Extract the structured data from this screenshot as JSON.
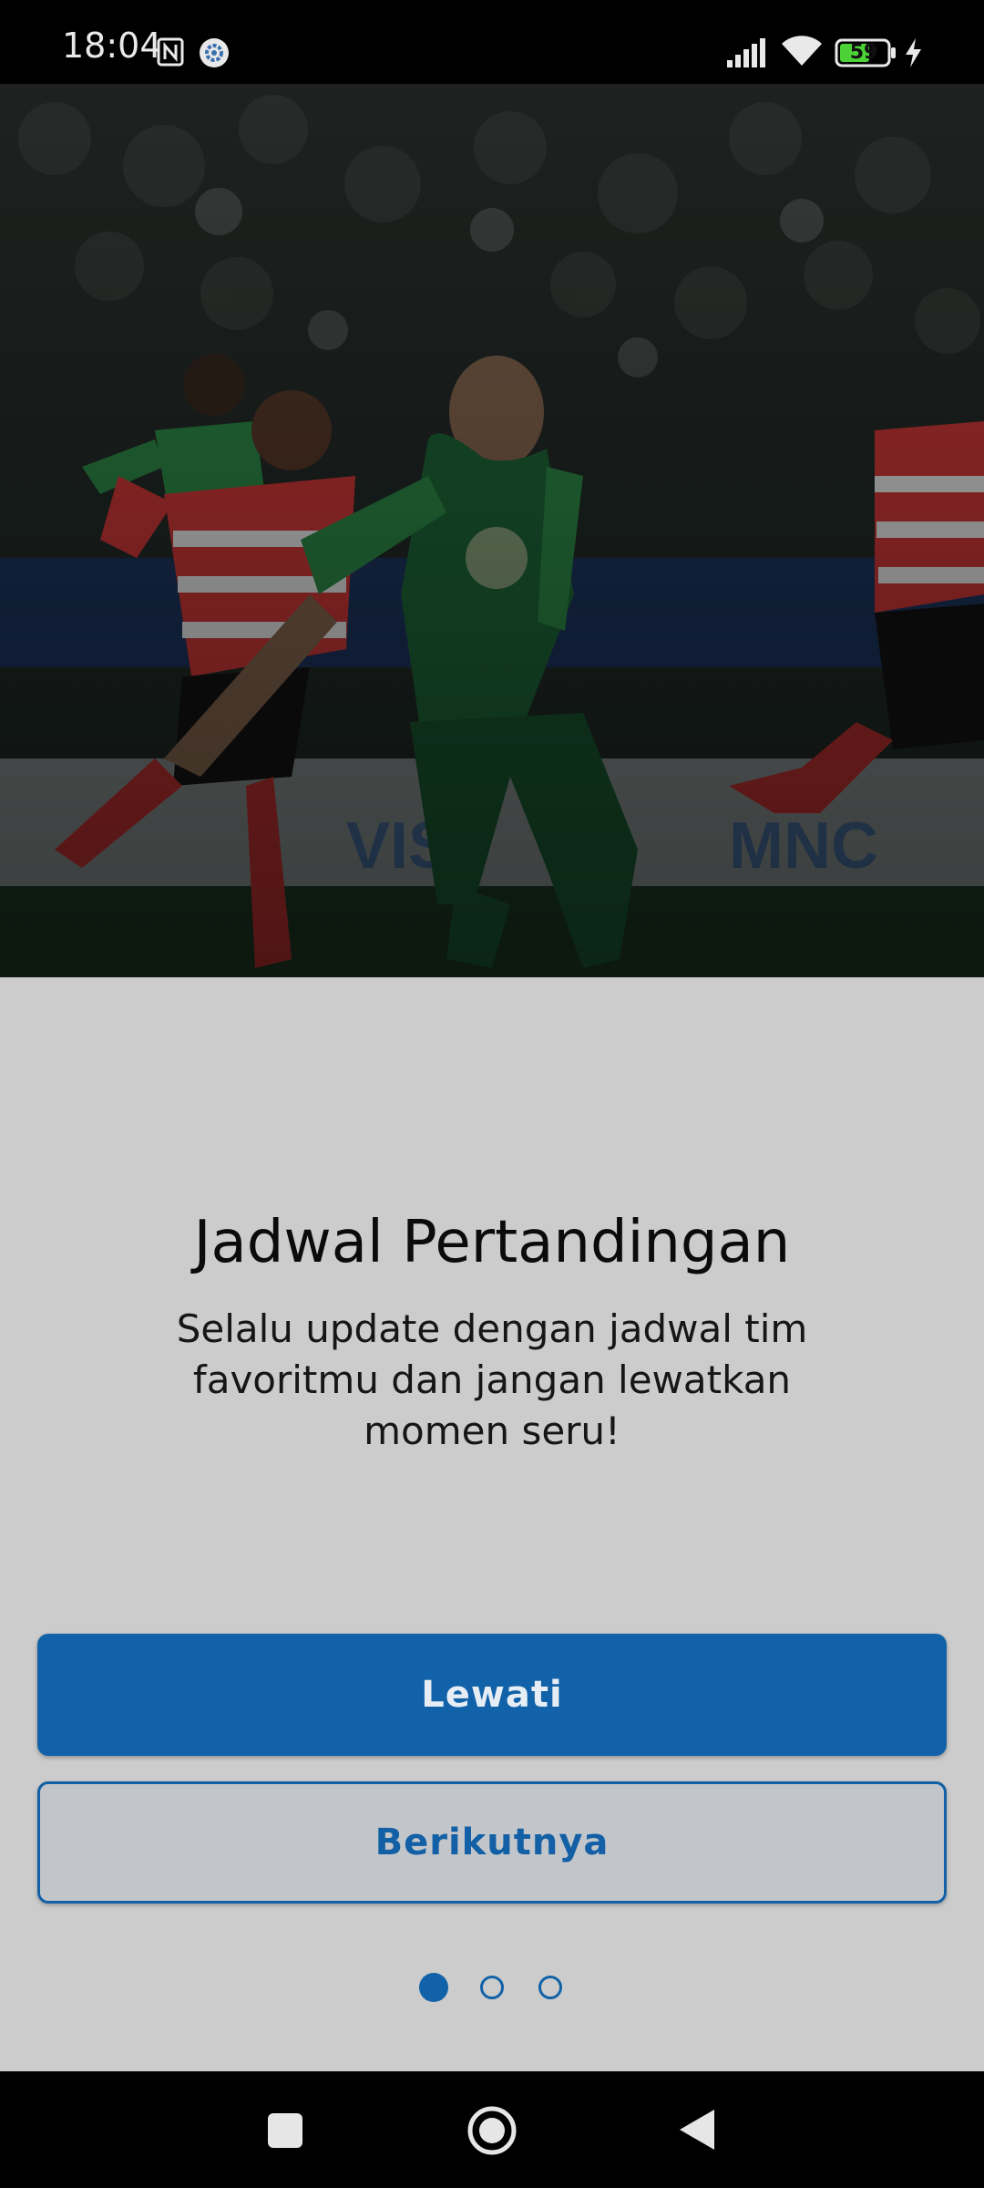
{
  "status_bar": {
    "time": "18:04",
    "battery_level": "59",
    "icons": [
      "nfc-icon",
      "gear-app-icon",
      "signal-icon",
      "wifi-icon",
      "battery-icon",
      "charging-icon"
    ]
  },
  "hero": {
    "image": "football-players-photo"
  },
  "onboarding": {
    "title": "Jadwal Pertandingan",
    "subtitle": "Selalu update dengan jadwal tim favoritmu dan jangan lewatkan momen seru!",
    "skip_label": "Lewati",
    "next_label": "Berikutnya",
    "page_count": 3,
    "current_page": 1
  },
  "nav_bar": {
    "icons": [
      "recents-icon",
      "home-icon",
      "back-icon"
    ]
  },
  "colors": {
    "primary": "#1162a8",
    "background": "#cccccc",
    "title_text": "#0b0b0b"
  }
}
